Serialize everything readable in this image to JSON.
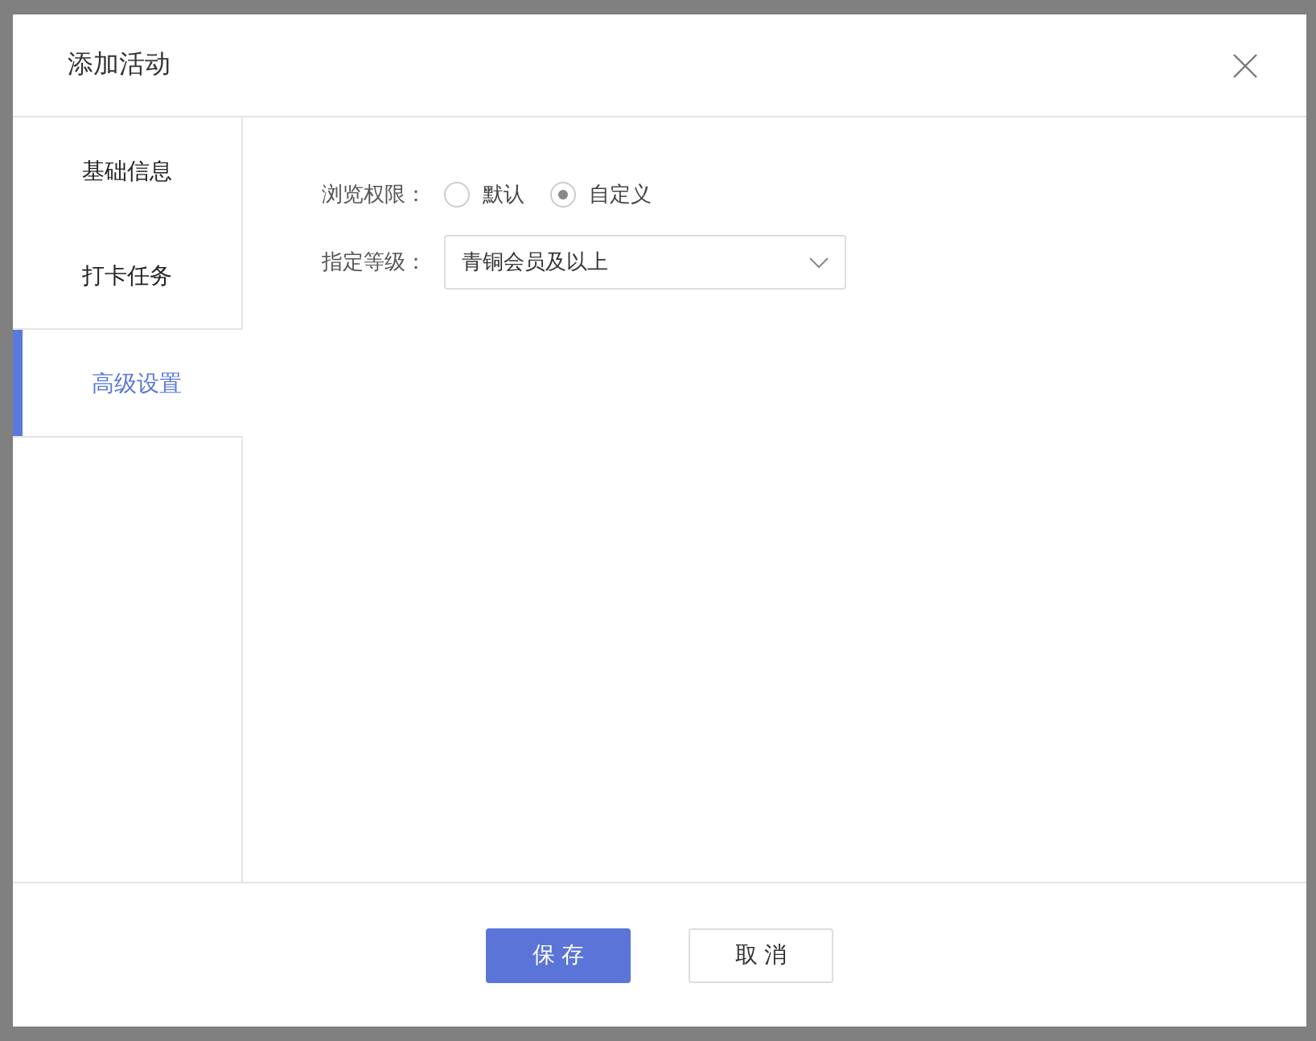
{
  "dialog": {
    "title": "添加活动"
  },
  "sidebar": {
    "items": [
      {
        "label": "基础信息",
        "selected": false
      },
      {
        "label": "打卡任务",
        "selected": false
      },
      {
        "label": "高级设置",
        "selected": true
      }
    ]
  },
  "form": {
    "view_permission": {
      "label": "浏览权限：",
      "options": [
        {
          "label": "默认",
          "selected": false
        },
        {
          "label": "自定义",
          "selected": true
        }
      ]
    },
    "level": {
      "label": "指定等级：",
      "value": "青铜会员及以上"
    }
  },
  "buttons": [
    {
      "label": "保存",
      "kind": "primary"
    },
    {
      "label": "取消",
      "kind": "secondary"
    }
  ]
}
